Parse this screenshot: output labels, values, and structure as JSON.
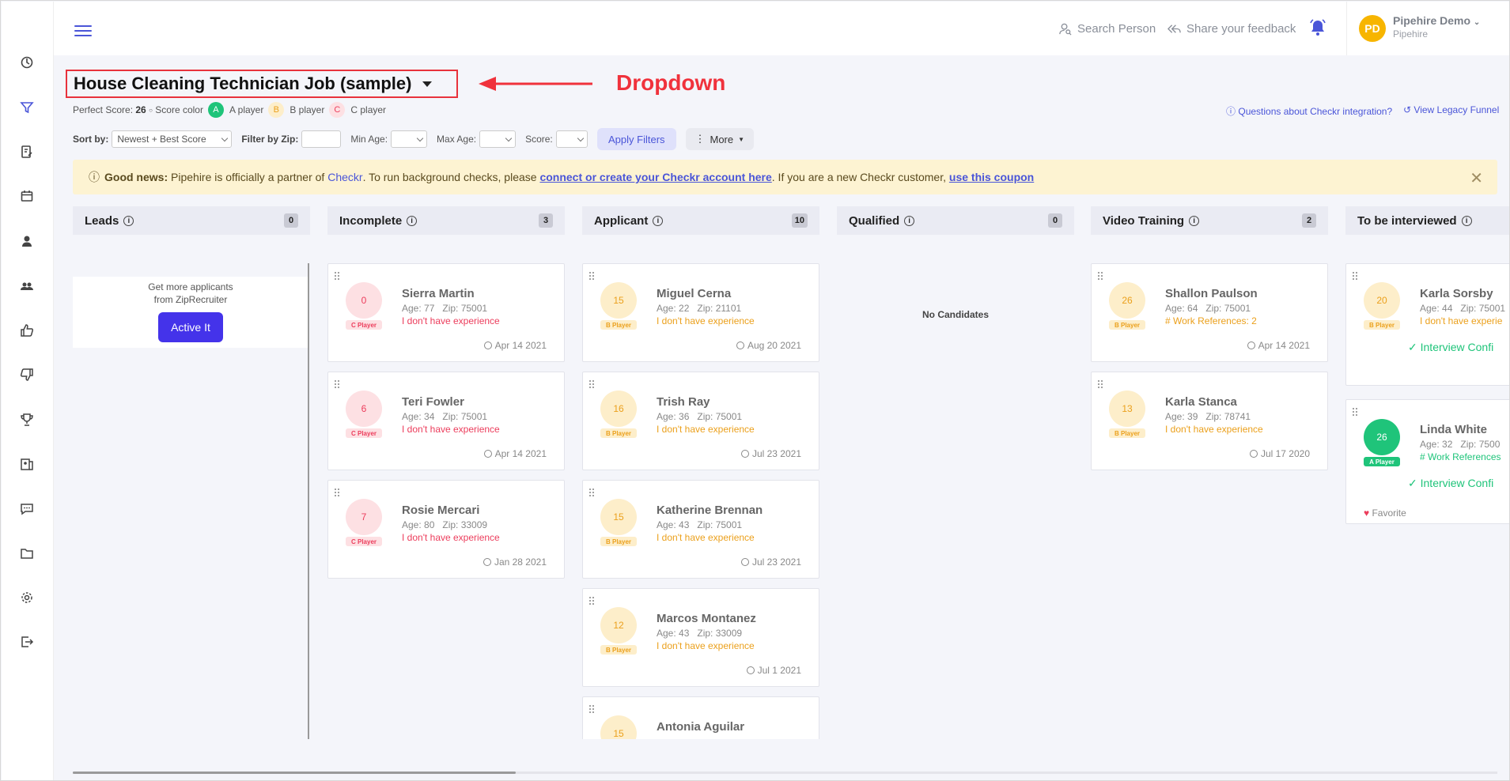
{
  "topbar": {
    "search_label": "Search Person",
    "feedback_label": "Share your feedback",
    "user_initials": "PD",
    "user_name": "Pipehire Demo",
    "user_org": "Pipehire"
  },
  "job": {
    "title": "House Cleaning Technician Job (sample)"
  },
  "annotation": {
    "label": "Dropdown",
    "color": "#f0323c"
  },
  "legend": {
    "perfect_label": "Perfect Score:",
    "perfect_value": "26",
    "score_color_label": "Score color",
    "a_letter": "A",
    "a_label": "A player",
    "b_letter": "B",
    "b_label": "B player",
    "c_letter": "C",
    "c_label": "C player"
  },
  "links": {
    "checkr_questions": "Questions about Checkr integration?",
    "legacy_funnel": "View Legacy Funnel"
  },
  "filters": {
    "sort_label": "Sort by:",
    "sort_value": "Newest + Best Score",
    "zip_label": "Filter by Zip:",
    "min_age_label": "Min Age:",
    "max_age_label": "Max Age:",
    "score_label": "Score:",
    "apply_label": "Apply Filters",
    "more_label": "More"
  },
  "banner": {
    "prefix": "Good news:",
    "text1": "Pipehire is officially a partner of",
    "checkr": "Checkr",
    "text2": ". To run background checks, please",
    "link1": "connect or create your Checkr account here",
    "text3": ". If you are a new Checkr customer,",
    "link2": "use this coupon"
  },
  "columns": [
    {
      "name": "Leads",
      "count": "0"
    },
    {
      "name": "Incomplete",
      "count": "3"
    },
    {
      "name": "Applicant",
      "count": "10"
    },
    {
      "name": "Qualified",
      "count": "0"
    },
    {
      "name": "Video Training",
      "count": "2"
    },
    {
      "name": "To be interviewed",
      "count": ""
    }
  ],
  "leads": {
    "line1": "Get more applicants",
    "line2": "from ZipRecruiter",
    "button": "Active It"
  },
  "qualified_empty": "No Candidates",
  "cards": {
    "incomplete": [
      {
        "score": "0",
        "tag": "C Player",
        "name": "Sierra Martin",
        "meta": "Age: 77   Zip: 75001",
        "note": "I don't have experience",
        "date": "Apr 14 2021"
      },
      {
        "score": "6",
        "tag": "C Player",
        "name": "Teri Fowler",
        "meta": "Age: 34   Zip: 75001",
        "note": "I don't have experience",
        "date": "Apr 14 2021"
      },
      {
        "score": "7",
        "tag": "C Player",
        "name": "Rosie Mercari",
        "meta": "Age: 80   Zip: 33009",
        "note": "I don't have experience",
        "date": "Jan 28 2021"
      }
    ],
    "applicant": [
      {
        "score": "15",
        "tag": "B Player",
        "name": "Miguel Cerna",
        "meta": "Age: 22   Zip: 21101",
        "note": "I don't have experience",
        "date": "Aug 20 2021"
      },
      {
        "score": "16",
        "tag": "B Player",
        "name": "Trish Ray",
        "meta": "Age: 36   Zip: 75001",
        "note": "I don't have experience",
        "date": "Jul 23 2021"
      },
      {
        "score": "15",
        "tag": "B Player",
        "name": "Katherine Brennan",
        "meta": "Age: 43   Zip: 75001",
        "note": "I don't have experience",
        "date": "Jul 23 2021"
      },
      {
        "score": "12",
        "tag": "B Player",
        "name": "Marcos Montanez",
        "meta": "Age: 43   Zip: 33009",
        "note": "I don't have experience",
        "date": "Jul 1 2021"
      },
      {
        "score": "15",
        "name": "Antonia Aguilar"
      }
    ],
    "video": [
      {
        "score": "26",
        "tag": "B Player",
        "name": "Shallon Paulson",
        "meta": "Age: 64   Zip: 75001",
        "note": "# Work References: 2",
        "date": "Apr 14 2021"
      },
      {
        "score": "13",
        "tag": "B Player",
        "name": "Karla Stanca",
        "meta": "Age: 39   Zip: 78741",
        "note": "I don't have experience",
        "date": "Jul 17 2020"
      }
    ],
    "interview": [
      {
        "score": "20",
        "tag": "B Player",
        "name": "Karla Sorsby",
        "meta": "Age: 44   Zip: 75001",
        "note": "I don't have experie",
        "status": "Interview Confi"
      },
      {
        "score": "26",
        "tag": "A Player",
        "name": "Linda White",
        "meta": "Age: 32   Zip: 7500",
        "note": "# Work References",
        "status": "Interview Confi",
        "favorite": "Favorite"
      }
    ]
  },
  "colors": {
    "accent": "#4a55d8",
    "c_player": "#ec3d5c",
    "b_player": "#eba01c",
    "a_player": "#1fc47a",
    "banner_bg": "#fdf3d2"
  }
}
